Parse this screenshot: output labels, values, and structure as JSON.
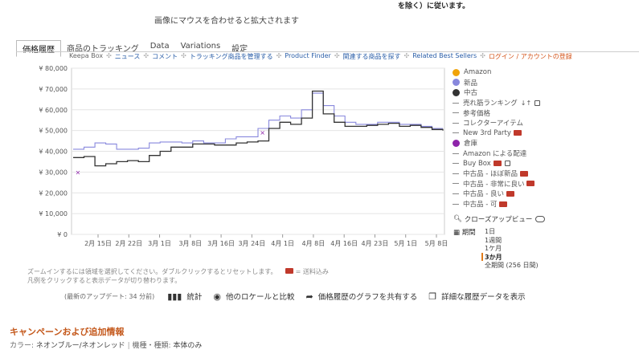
{
  "top_note": "を除く）に従います。",
  "zoom_hint": "画像にマウスを合わせると拡大されます",
  "tabs": [
    "価格履歴",
    "商品のトラッキング",
    "Data",
    "Variations",
    "設定"
  ],
  "nav": {
    "keepa_box": "Keepa Box",
    "news": "ニュース",
    "comment": "コメント",
    "manage": "トラッキング商品を管理する",
    "finder": "Product Finder",
    "related": "関連する商品を探す",
    "best": "Related Best Sellers",
    "login": "ログイン / アカウントの登録"
  },
  "legend": {
    "amazon": "Amazon",
    "new": "新品",
    "used": "中古",
    "rank": "売れ筋ランキング",
    "ref": "参考価格",
    "collector": "コレクターアイテム",
    "new3rd": "New 3rd Party",
    "warehouse": "倉庫",
    "fba": "Amazon による配達",
    "buybox": "Buy Box",
    "used_like_new": "中古品 - ほぼ新品",
    "used_very_good": "中古品 - 非常に良い",
    "used_good": "中古品 - 良い",
    "used_acceptable": "中古品 - 可"
  },
  "closeup_label": "クローズアップビュー",
  "period": {
    "label": "期間",
    "options": [
      "1日",
      "1週間",
      "1ケ月",
      "3か月",
      "全期間 (256 日間)"
    ],
    "selected": "3か月"
  },
  "hint1": "ズームインするには領域を選択してください。ダブルクリックするとリセットします。",
  "hint1b": "= 送料込み",
  "hint2": "凡例をクリックすると表示データが切り替わります。",
  "last_update": "(最新のアップデート: 34 分前)",
  "actions": {
    "stats": "統計",
    "compare": "他のロケールと比較",
    "share": "価格履歴のグラフを共有する",
    "detail": "詳細な履歴データを表示"
  },
  "section_heading": "キャンペーンおよび追加情報",
  "color_line": {
    "label": "カラー:",
    "value": "ネオンブルー/ネオンレッド",
    "label2": "機種・種類:",
    "value2": "本体のみ"
  },
  "colors": {
    "new": "#8888dd",
    "used": "#333333",
    "amazon": "#f0a30a",
    "warehouse": "#8e24aa",
    "accent": "#c4581b"
  },
  "chart_data": {
    "type": "line",
    "ylim": [
      0,
      80000
    ],
    "y_ticks": [
      "¥ 0",
      "¥ 10,000",
      "¥ 20,000",
      "¥ 30,000",
      "¥ 40,000",
      "¥ 50,000",
      "¥ 60,000",
      "¥ 70,000",
      "¥ 80,000"
    ],
    "x_ticks": [
      "2月 15日",
      "2月 22日",
      "3月 1日",
      "3月 8日",
      "3月 16日",
      "3月 24日",
      "4月 1日",
      "4月 8日",
      "4月 16日",
      "4月 23日",
      "5月 1日",
      "5月 8日"
    ],
    "series": [
      {
        "name": "新品",
        "color": "#8888dd",
        "values": [
          41000,
          42000,
          44000,
          43500,
          41000,
          41000,
          41500,
          44000,
          44500,
          44500,
          44000,
          45000,
          44000,
          44000,
          46000,
          47000,
          47000,
          51000,
          55000,
          57000,
          56000,
          60000,
          68000,
          62000,
          57000,
          54000,
          53000,
          53000,
          54000,
          54000,
          53000,
          53000,
          52000,
          51000,
          51000
        ]
      },
      {
        "name": "中古",
        "color": "#333333",
        "values": [
          37000,
          37500,
          33000,
          34000,
          35000,
          35500,
          35000,
          38000,
          40000,
          42000,
          42000,
          43500,
          43500,
          43000,
          43000,
          44000,
          44500,
          45000,
          51000,
          54000,
          53000,
          56000,
          69000,
          58000,
          54000,
          52000,
          52000,
          52500,
          53000,
          53500,
          52000,
          52500,
          51500,
          50500,
          50000
        ]
      },
      {
        "name": "倉庫",
        "color": "#8e24aa",
        "points": [
          [
            "2月 15日",
            30000
          ],
          [
            "4月 1日",
            49000
          ]
        ]
      }
    ]
  }
}
